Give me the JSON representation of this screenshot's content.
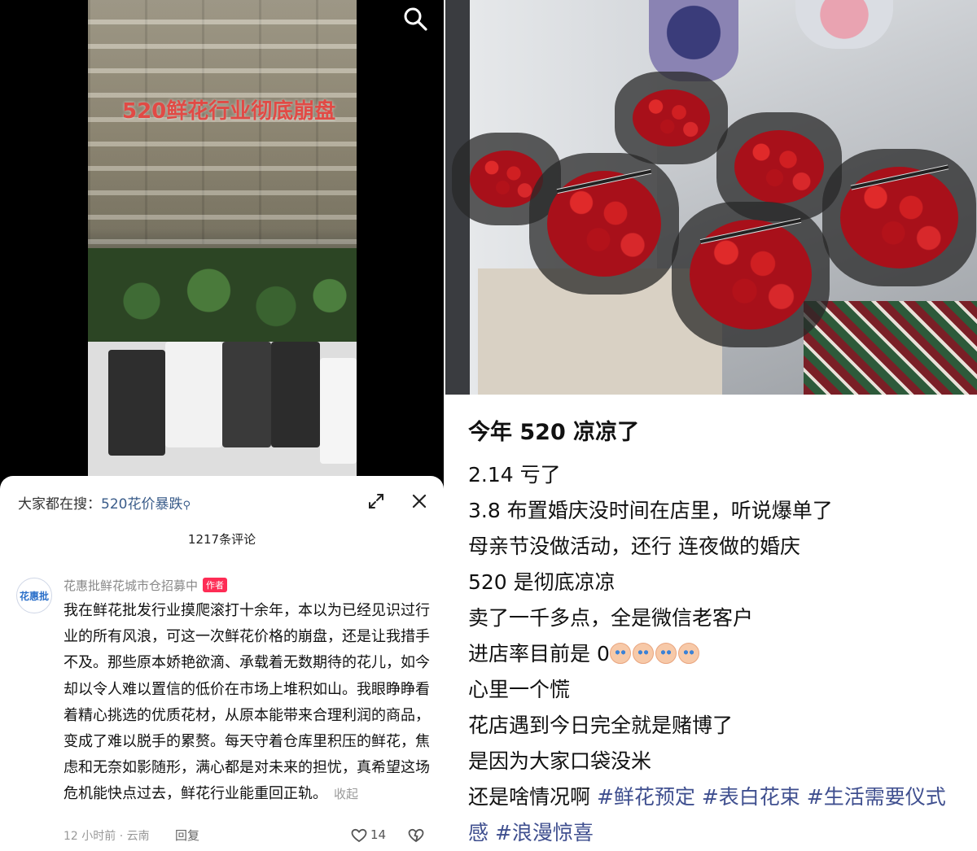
{
  "left": {
    "video_caption": "520鲜花行业彻底崩盘",
    "search": {
      "label": "大家都在搜：",
      "query": "520花价暴跌"
    },
    "comment_count": "1217条评论",
    "comment": {
      "author": "花惠批鲜花城市仓招募中",
      "avatar_text": "花惠批",
      "badge": "作者",
      "text": "我在鲜花批发行业摸爬滚打十余年，本以为已经见识过行业的所有风浪，可这一次鲜花价格的崩盘，还是让我措手不及。那些原本娇艳欲滴、承载着无数期待的花儿，如今却以令人难以置信的低价在市场上堆积如山。我眼睁睁看着精心挑选的优质花材，从原本能带来合理利润的商品，变成了难以脱手的累赘。每天守着仓库里积压的鲜花，焦虑和无奈如影随形，满心都是对未来的担忧，真希望这场危机能快点过去，鲜花行业能重回正轨。",
      "collapse": "收起",
      "time_location": "12 小时前 · 云南",
      "reply": "回复",
      "likes": "14"
    }
  },
  "right": {
    "title": "今年 520 凉凉了",
    "lines": [
      "2.14 亏了",
      "3.8 布置婚庆没时间在店里，听说爆单了",
      "母亲节没做活动，还行 连夜做的婚庆",
      "520 是彻底凉凉",
      "卖了一千多点，全是微信老客户"
    ],
    "entry_rate": "进店率目前是 0",
    "lines2": [
      "心里一个慌",
      "花店遇到今日完全就是赌博了",
      "是因为大家口袋没米"
    ],
    "last_line_prefix": "还是啥情况啊 ",
    "hashtags": [
      "#鲜花预定",
      "#表白花束",
      "#生活需要仪式感",
      "#浪漫惊喜"
    ]
  },
  "colors": {
    "accent_red": "#fe2c55",
    "hashtag_blue": "#3f4f8f",
    "trend_blue": "#3a5c8a"
  },
  "icons": [
    "search-icon",
    "expand-icon",
    "close-icon",
    "heart-icon",
    "dislike-icon",
    "crying-emoji"
  ]
}
